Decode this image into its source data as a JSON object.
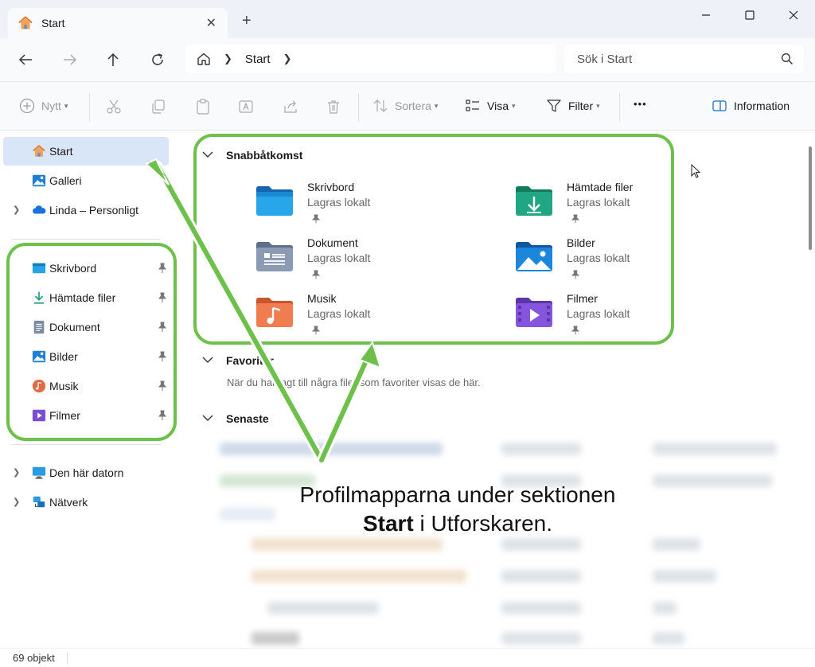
{
  "window": {
    "tab_title": "Start",
    "new_tab": "+"
  },
  "navigation": {
    "breadcrumb_current": "Start",
    "search_placeholder": "Sök i Start"
  },
  "toolbar": {
    "new_label": "Nytt",
    "sort_label": "Sortera",
    "view_label": "Visa",
    "filter_label": "Filter",
    "more_label": "•••",
    "info_label": "Information"
  },
  "sidebar": {
    "top_items": [
      {
        "label": "Start",
        "icon": "home-icon",
        "selected": true
      },
      {
        "label": "Galleri",
        "icon": "gallery-icon"
      },
      {
        "label": "Linda – Personligt",
        "icon": "onedrive-icon",
        "expandable": true
      }
    ],
    "pinned_items": [
      {
        "label": "Skrivbord",
        "icon": "desktop-folder-icon"
      },
      {
        "label": "Hämtade filer",
        "icon": "downloads-icon"
      },
      {
        "label": "Dokument",
        "icon": "documents-icon"
      },
      {
        "label": "Bilder",
        "icon": "pictures-icon"
      },
      {
        "label": "Musik",
        "icon": "music-icon"
      },
      {
        "label": "Filmer",
        "icon": "videos-icon"
      }
    ],
    "bottom_items": [
      {
        "label": "Den här datorn",
        "icon": "this-pc-icon",
        "expandable": true
      },
      {
        "label": "Nätverk",
        "icon": "network-icon",
        "expandable": true
      }
    ]
  },
  "main": {
    "quick_access": {
      "heading": "Snabbåtkomst",
      "items": [
        {
          "name": "Skrivbord",
          "sub": "Lagras lokalt",
          "icon": "desktop-folder-icon",
          "color": "#1f8fd6"
        },
        {
          "name": "Hämtade filer",
          "sub": "Lagras lokalt",
          "icon": "downloads-folder-icon",
          "color": "#1f9b78"
        },
        {
          "name": "Dokument",
          "sub": "Lagras lokalt",
          "icon": "documents-folder-icon",
          "color": "#7d8fa8"
        },
        {
          "name": "Bilder",
          "sub": "Lagras lokalt",
          "icon": "pictures-folder-icon",
          "color": "#1c7fd4"
        },
        {
          "name": "Musik",
          "sub": "Lagras lokalt",
          "icon": "music-folder-icon",
          "color": "#e8744a"
        },
        {
          "name": "Filmer",
          "sub": "Lagras lokalt",
          "icon": "videos-folder-icon",
          "color": "#7a4fd0"
        }
      ]
    },
    "favorites": {
      "heading": "Favoriter",
      "note": "När du har lagt till några filer som favoriter visas de här."
    },
    "recent": {
      "heading": "Senaste"
    }
  },
  "status": {
    "count": "69 objekt"
  },
  "annotation": {
    "caption_line1": "Profilmapparna under sektionen",
    "caption_bold": "Start",
    "caption_rest": " i Utforskaren.",
    "color": "#6dc04a"
  }
}
